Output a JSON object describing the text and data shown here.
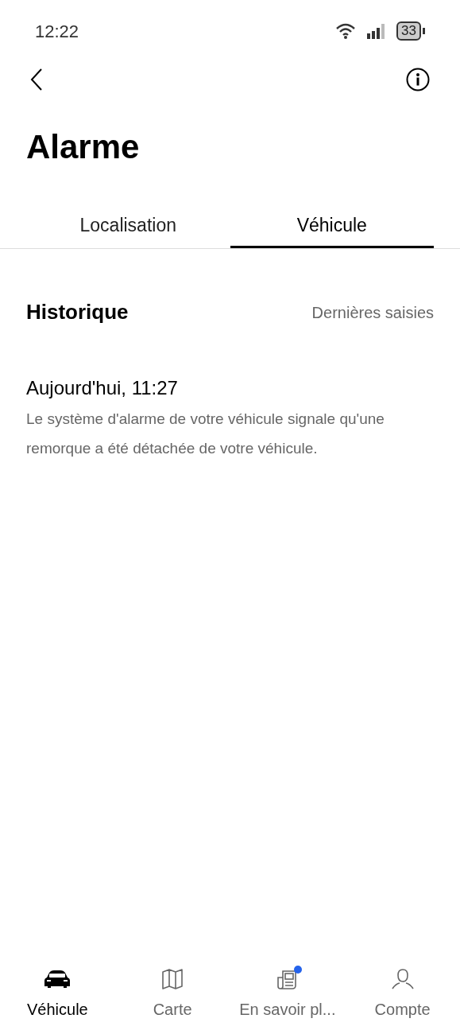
{
  "status_bar": {
    "time": "12:22",
    "battery": "33"
  },
  "header": {
    "title": "Alarme"
  },
  "tabs": [
    {
      "label": "Localisation",
      "selected": false
    },
    {
      "label": "Véhicule",
      "selected": true
    }
  ],
  "history": {
    "title": "Historique",
    "filter": "Dernières saisies",
    "entries": [
      {
        "time": "Aujourd'hui, 11:27",
        "message": "Le système d'alarme de votre véhicule signale qu'une remorque a été détachée de votre véhicule."
      }
    ]
  },
  "bottom_nav": [
    {
      "kind": "car",
      "label": "Véhicule",
      "selected": true,
      "badge": false
    },
    {
      "kind": "map",
      "label": "Carte",
      "selected": false,
      "badge": false
    },
    {
      "kind": "news",
      "label": "En savoir pl...",
      "selected": false,
      "badge": true
    },
    {
      "kind": "person",
      "label": "Compte",
      "selected": false,
      "badge": false
    }
  ]
}
